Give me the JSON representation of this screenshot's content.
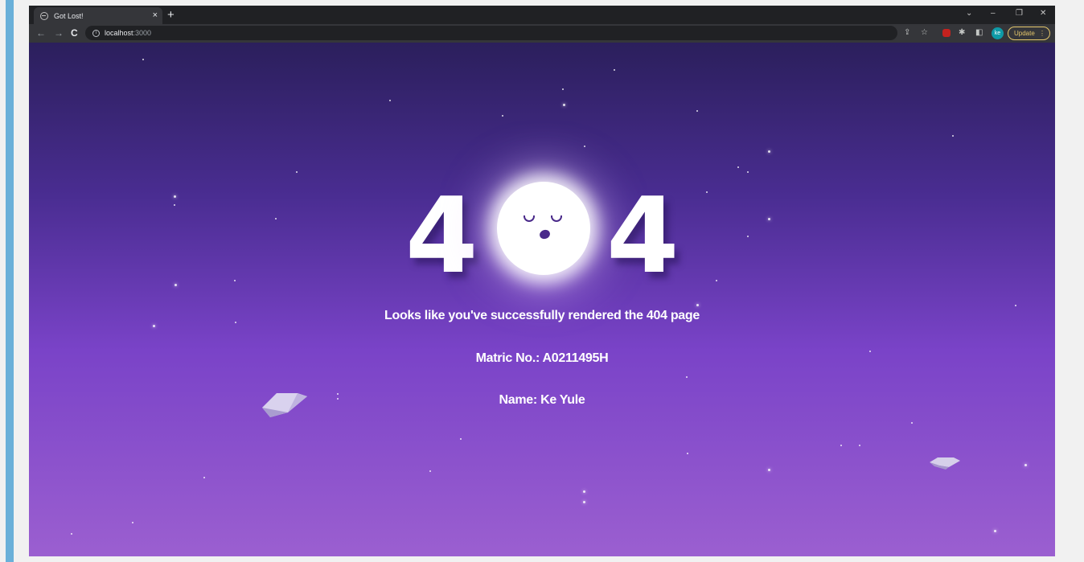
{
  "browser": {
    "tab_title": "Got Lost!",
    "tab_close": "×",
    "new_tab": "+",
    "url_host": "localhost",
    "url_port": ":3000",
    "update_label": "Update",
    "avatar_initials": "ke"
  },
  "page": {
    "digit_left": "4",
    "digit_right": "4",
    "message": "Looks like you've successfully rendered the 404 page",
    "matric": "Matric No.: A0211495H",
    "name": "Name: Ke Yule"
  },
  "colors": {
    "sky_top": "#2b1f5c",
    "sky_bottom": "#9b5fd0",
    "update_accent": "#e4c66b",
    "avatar_bg": "#0e9aa7"
  }
}
